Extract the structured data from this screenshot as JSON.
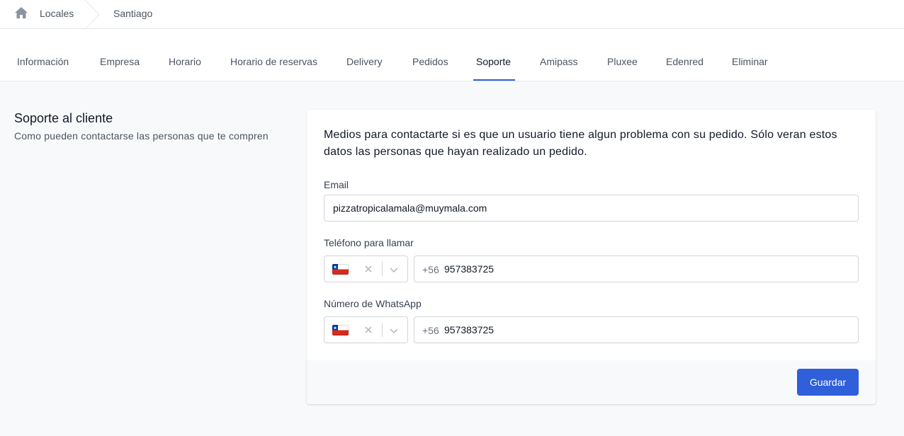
{
  "breadcrumb": {
    "items": [
      "Locales",
      "Santiago"
    ]
  },
  "tabs": [
    {
      "label": "Información"
    },
    {
      "label": "Empresa"
    },
    {
      "label": "Horario"
    },
    {
      "label": "Horario de reservas"
    },
    {
      "label": "Delivery"
    },
    {
      "label": "Pedidos"
    },
    {
      "label": "Soporte",
      "active": true
    },
    {
      "label": "Amipass"
    },
    {
      "label": "Pluxee"
    },
    {
      "label": "Edenred"
    },
    {
      "label": "Eliminar"
    }
  ],
  "section": {
    "title": "Soporte al cliente",
    "description": "Como pueden contactarse las personas que te compren"
  },
  "form": {
    "intro": "Medios para contactarte si es que un usuario tiene algun problema con su pedido. Sólo veran estos datos las personas que hayan realizado un pedido.",
    "email": {
      "label": "Email",
      "value": "pizzatropicalamala@muymala.com"
    },
    "phone": {
      "label": "Teléfono para llamar",
      "country_icon": "chile-flag-icon",
      "prefix": "+56",
      "value": "957383725"
    },
    "whatsapp": {
      "label": "Número de WhatsApp",
      "country_icon": "chile-flag-icon",
      "prefix": "+56",
      "value": "957383725"
    },
    "save_label": "Guardar"
  },
  "colors": {
    "accent": "#2f5fd9",
    "background": "#f8f9fb"
  }
}
